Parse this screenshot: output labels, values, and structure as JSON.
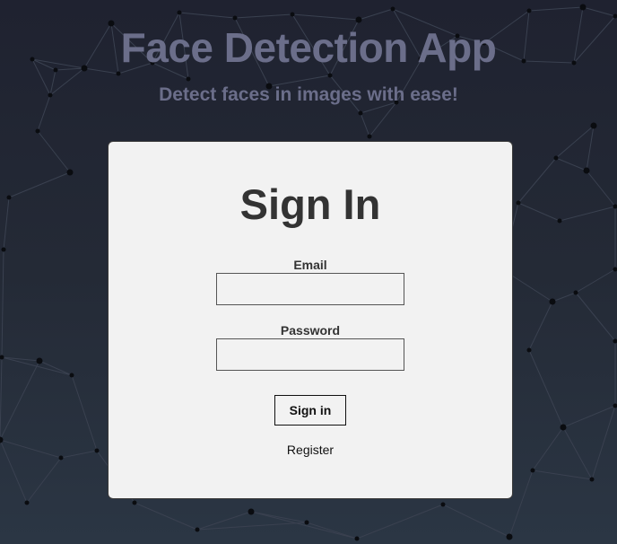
{
  "header": {
    "title": "Face Detection App",
    "subtitle": "Detect faces in images with ease!"
  },
  "signin_form": {
    "title": "Sign In",
    "email_label": "Email",
    "email_value": "",
    "password_label": "Password",
    "password_value": "",
    "submit_label": "Sign in",
    "register_label": "Register"
  },
  "colors": {
    "background_top": "#1f2230",
    "background_bottom": "#2b3644",
    "header_text": "#6b6e8a",
    "card_background": "#f2f2f2",
    "card_text": "#333333"
  }
}
